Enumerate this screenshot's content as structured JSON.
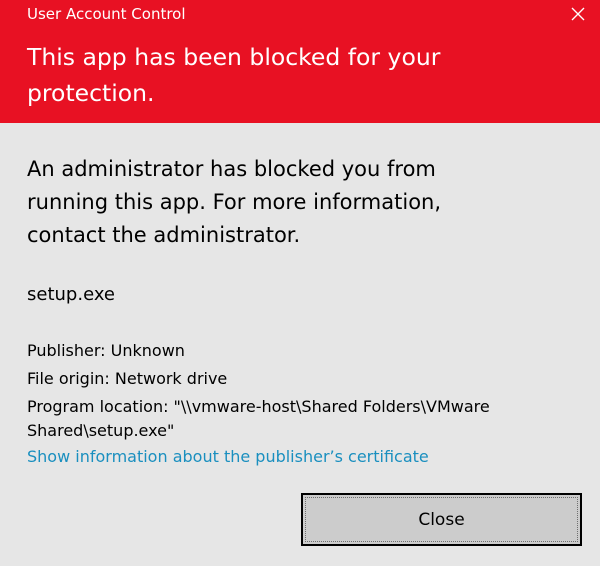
{
  "window": {
    "title": "User Account Control"
  },
  "header": {
    "headline": "This app has been blocked for your protection."
  },
  "content": {
    "message": "An administrator has blocked you from running this app. For more information, contact the administrator.",
    "app_name": "setup.exe",
    "publisher": "Publisher: Unknown",
    "file_origin": "File origin: Network drive",
    "program_location": "Program location: \"\\\\vmware-host\\Shared Folders\\VMware Shared\\setup.exe\"",
    "certificate_link": "Show information about the publisher’s certificate"
  },
  "buttons": {
    "close_label": "Close"
  },
  "colors": {
    "header_background": "#e81123",
    "body_background": "#e6e6e6",
    "link": "#1a8fbf",
    "button_background": "#cccccc"
  },
  "icons": {
    "window_close": "close-icon"
  }
}
